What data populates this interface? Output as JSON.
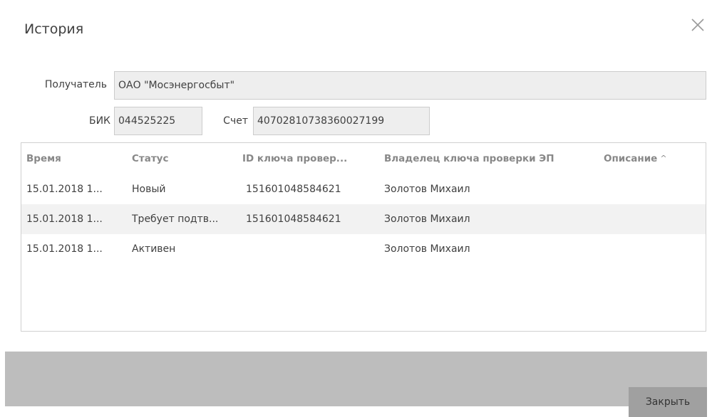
{
  "dialog": {
    "title": "История"
  },
  "recipient": {
    "label": "Получатель",
    "value": "ОАО \"Мосэнергосбыт\""
  },
  "bik": {
    "label": "БИК",
    "value": "044525225"
  },
  "account": {
    "label": "Счет",
    "value": "40702810738360027199"
  },
  "table": {
    "columns": [
      "Время",
      "Статус",
      "ID ключа провер...",
      "Владелец ключа проверки ЭП",
      "Описание"
    ],
    "sort_indicator": "^",
    "rows": [
      [
        "15.01.2018 1...",
        "Новый",
        "151601048584621",
        "Золотов Михаил",
        ""
      ],
      [
        "15.01.2018 1...",
        "Требует подтв...",
        "151601048584621",
        "Золотов Михаил",
        ""
      ],
      [
        "15.01.2018 1...",
        "Активен",
        "",
        "Золотов Михаил",
        ""
      ]
    ]
  },
  "footer": {
    "close_label": "Закрыть"
  },
  "icons": {
    "close": "close-icon",
    "sort": "sort-ascending-icon"
  },
  "colors": {
    "footer_bg": "#bdbdbd",
    "button_bg": "#a0a0a0",
    "field_bg": "#eeeeee",
    "alt_row_bg": "#f2f2f2"
  }
}
